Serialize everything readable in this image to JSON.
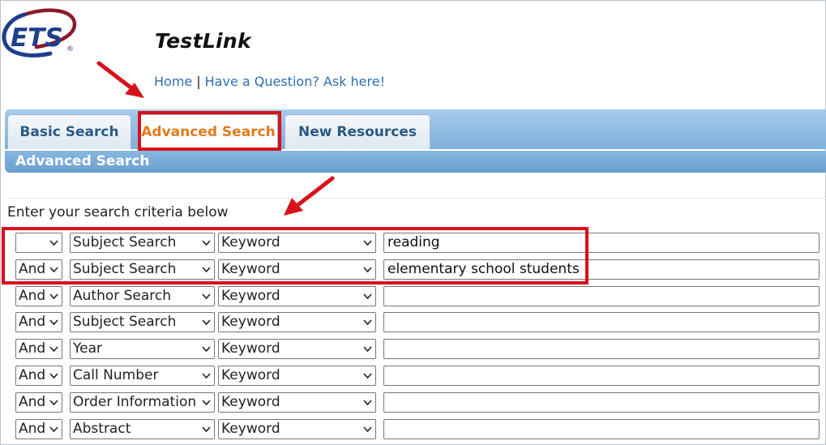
{
  "logo": {
    "text": "ETS",
    "mark": "®"
  },
  "app": {
    "title": "TestLink"
  },
  "links": {
    "home": "Home",
    "separator": "|",
    "question": "Have a Question? Ask here!"
  },
  "tabs": [
    {
      "label": "Basic Search",
      "active": false
    },
    {
      "label": "Advanced Search",
      "active": true
    },
    {
      "label": "New Resources",
      "active": false
    }
  ],
  "subheader": "Advanced Search",
  "criteria_label": "Enter your search criteria below",
  "rows": [
    {
      "bool": "",
      "field": "Subject Search",
      "mode": "Keyword",
      "value": "reading"
    },
    {
      "bool": "And",
      "field": "Subject Search",
      "mode": "Keyword",
      "value": "elementary school students"
    },
    {
      "bool": "And",
      "field": "Author Search",
      "mode": "Keyword",
      "value": ""
    },
    {
      "bool": "And",
      "field": "Subject Search",
      "mode": "Keyword",
      "value": ""
    },
    {
      "bool": "And",
      "field": "Year",
      "mode": "Keyword",
      "value": ""
    },
    {
      "bool": "And",
      "field": "Call Number",
      "mode": "Keyword",
      "value": ""
    },
    {
      "bool": "And",
      "field": "Order Information",
      "mode": "Keyword",
      "value": ""
    },
    {
      "bool": "And",
      "field": "Abstract",
      "mode": "Keyword",
      "value": ""
    }
  ],
  "colors": {
    "annotation": "#d8111b",
    "tab_bar": "#7fb0dc",
    "active_tab_text": "#e07a1c",
    "link": "#2e6fb0",
    "logo": "#1f3e8c"
  }
}
